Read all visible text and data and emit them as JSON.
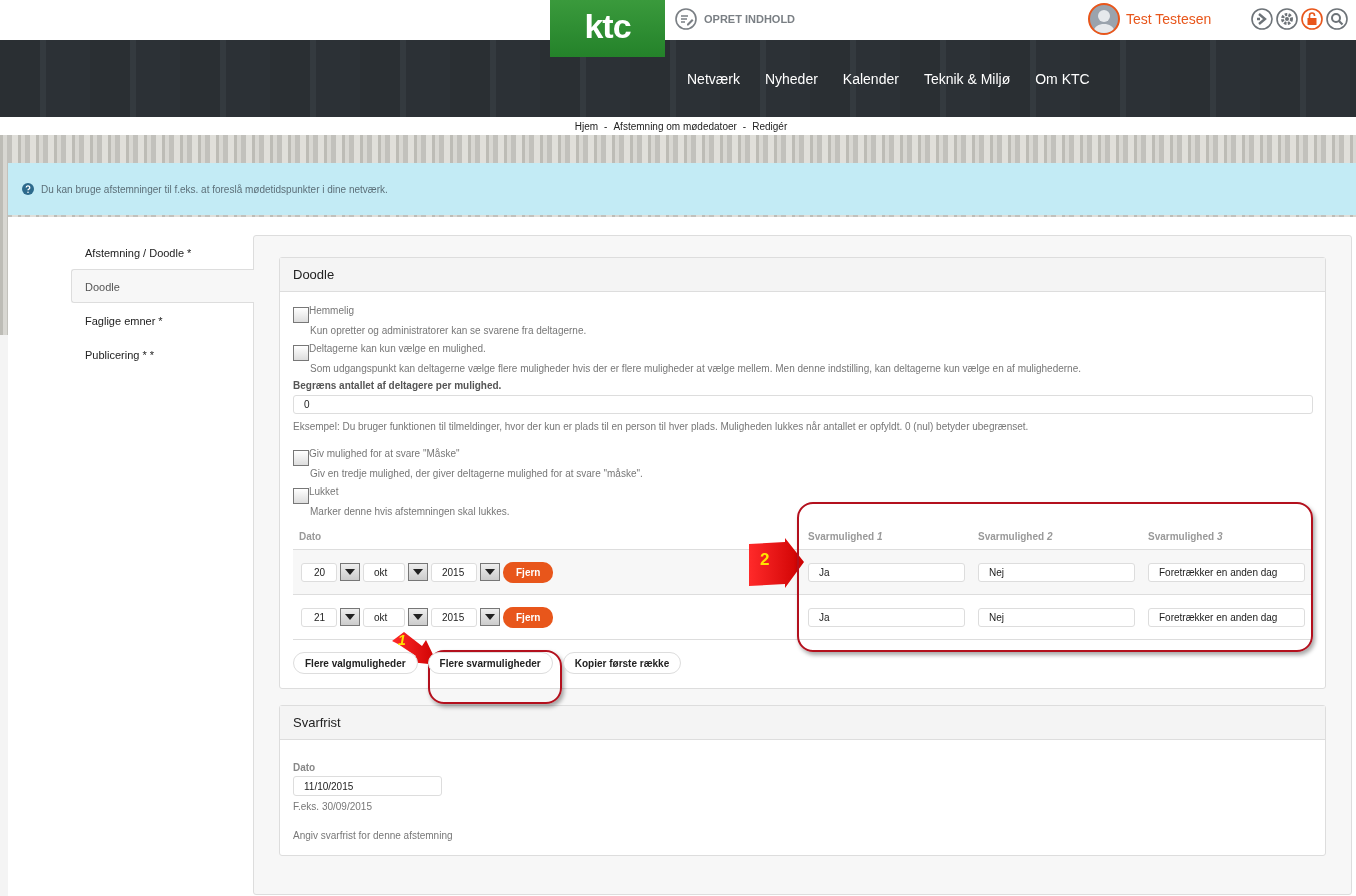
{
  "header": {
    "logo": "ktc",
    "create_link": "OPRET INDHOLD",
    "user_name": "Test Testesen"
  },
  "nav": [
    "Netværk",
    "Nyheder",
    "Kalender",
    "Teknik & Miljø",
    "Om KTC"
  ],
  "breadcrumb": {
    "items": [
      "Hjem",
      "Afstemning om mødedatoer",
      "Redigér"
    ],
    "separator": "-"
  },
  "info": "Du kan bruge afstemninger til f.eks. at foreslå mødetidspunkter i dine netværk.",
  "sidebar": [
    {
      "label": "Afstemning / Doodle *",
      "selected": false
    },
    {
      "label": "Doodle",
      "selected": true
    },
    {
      "label": "Faglige emner *",
      "selected": false
    },
    {
      "label": "Publicering * *",
      "selected": false
    }
  ],
  "doodle": {
    "title": "Doodle",
    "options": [
      {
        "kind": "checkbox",
        "label": "Hemmelig",
        "checked": false,
        "help": "Kun opretter og administratorer kan se svarene fra deltagerne."
      },
      {
        "kind": "checkbox",
        "label": "Deltagerne kan kun vælge en mulighed.",
        "checked": false,
        "help": "Som udgangspunkt kan deltagerne vælge flere muligheder hvis der er flere muligheder at vælge mellem. Men denne indstilling, kan deltagerne kun vælge en af mulighederne."
      },
      {
        "kind": "number",
        "label": "Begræns antallet af deltagere per mulighed.",
        "value": "0",
        "help": "Eksempel: Du bruger funktionen til tilmeldinger, hvor der kun er plads til en person til hver plads. Muligheden lukkes når antallet er opfyldt. 0 (nul) betyder ubegrænset."
      },
      {
        "kind": "checkbox",
        "label": "Giv mulighed for at svare \"Måske\"",
        "checked": false,
        "help": "Giv en tredje mulighed, der giver deltagerne mulighed for at svare \"måske\"."
      },
      {
        "kind": "checkbox",
        "label": "Lukket",
        "checked": false,
        "help": "Marker denne hvis afstemningen skal lukkes."
      }
    ],
    "date_column": "Dato",
    "answer_columns": [
      "Svarmulighed *1*",
      "Svarmulighed *2*",
      "Svarmulighed *3*"
    ],
    "rows": [
      {
        "day": "20",
        "month": "okt",
        "year": "2015",
        "remove": "Fjern",
        "answers": [
          "Ja",
          "Nej",
          "Foretrækker en anden dag"
        ]
      },
      {
        "day": "21",
        "month": "okt",
        "year": "2015",
        "remove": "Fjern",
        "answers": [
          "Ja",
          "Nej",
          "Foretrækker en anden dag"
        ]
      }
    ],
    "buttons": [
      "Flere valgmuligheder",
      "Flere svarmuligheder",
      "Kopier første række"
    ],
    "annotations": [
      {
        "label": "1"
      },
      {
        "label": "2"
      }
    ]
  },
  "deadline": {
    "title": "Svarfrist",
    "label": "Dato",
    "value": "11/10/2015",
    "example": "F.eks. 30/09/2015",
    "help": "Angiv svarfrist for denne afstemning"
  }
}
